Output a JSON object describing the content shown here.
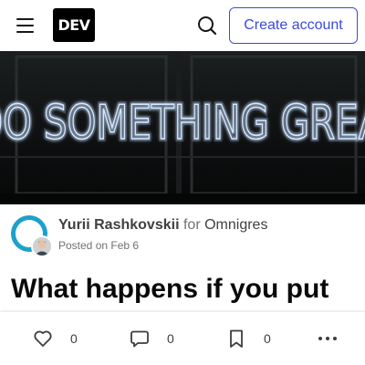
{
  "header": {
    "logo_text": "DEV",
    "create_account_label": "Create account",
    "accent_color": "#3b49df"
  },
  "cover": {
    "neon_text": "DO SOMETHING GREAT"
  },
  "author": {
    "name": "Yurii Rashkovskii",
    "for_word": "for",
    "organization": "Omnigres",
    "posted_prefix": "Posted on",
    "posted_date": "Feb 6"
  },
  "article": {
    "title": "What happens if you put"
  },
  "actions": {
    "likes": "0",
    "comments": "0",
    "saves": "0"
  },
  "icons": {
    "menu": "hamburger-icon",
    "search": "search-icon",
    "like": "heart-icon",
    "comment": "comment-icon",
    "save": "bookmark-icon",
    "more": "more-horizontal-icon"
  }
}
